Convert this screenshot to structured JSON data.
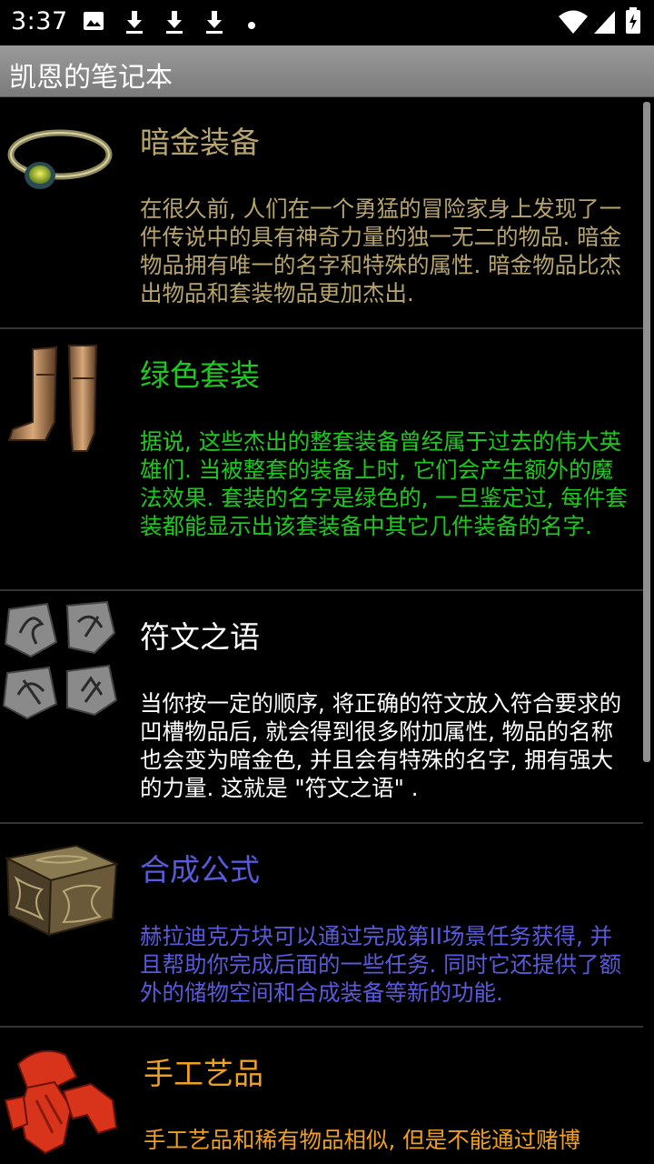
{
  "status_bar": {
    "time": "3:37",
    "left_icons": [
      "image-icon",
      "download-icon",
      "download-icon",
      "download-icon",
      "dot-icon"
    ],
    "right_icons": [
      "wifi-icon",
      "signal-icon",
      "battery-icon"
    ]
  },
  "app_bar": {
    "title": "凯恩的笔记本"
  },
  "items": [
    {
      "title": "暗金装备",
      "description": "在很久前, 人们在一个勇猛的冒险家身上发现了一件传说中的具有神奇力量的独一无二的物品. 暗金物品拥有唯一的名字和特殊的属性. 暗金物品比杰出物品和套装物品更加杰出.",
      "color": "#b8a56e",
      "icon": "ring-icon"
    },
    {
      "title": "绿色套装",
      "description": "据说, 这些杰出的整套装备曾经属于过去的伟大英雄们. 当被整套的装备上时, 它们会产生额外的魔法效果. 套装的名字是绿色的, 一旦鉴定过, 每件套装都能显示出该套装备中其它几件装备的名字.",
      "color": "#1ec81e",
      "icon": "boots-icon"
    },
    {
      "title": "符文之语",
      "description": "当你按一定的顺序, 将正确的符文放入符合要求的凹槽物品后, 就会得到很多附加属性, 物品的名称也会变为暗金色, 并且会有特殊的名字, 拥有强大的力量. 这就是 \"符文之语\" .",
      "color": "#ffffff",
      "icon": "runes-icon"
    },
    {
      "title": "合成公式",
      "description": "赫拉迪克方块可以通过完成第II场景任务获得, 并且帮助你完成后面的一些任务. 同时它还提供了额外的储物空间和合成装备等新的功能.",
      "color": "#5a5adc",
      "icon": "cube-icon"
    },
    {
      "title": "手工艺品",
      "description": "手工艺品和稀有物品相似, 但是不能通过赌博",
      "color": "#f0a020",
      "icon": "gloves-icon"
    }
  ]
}
